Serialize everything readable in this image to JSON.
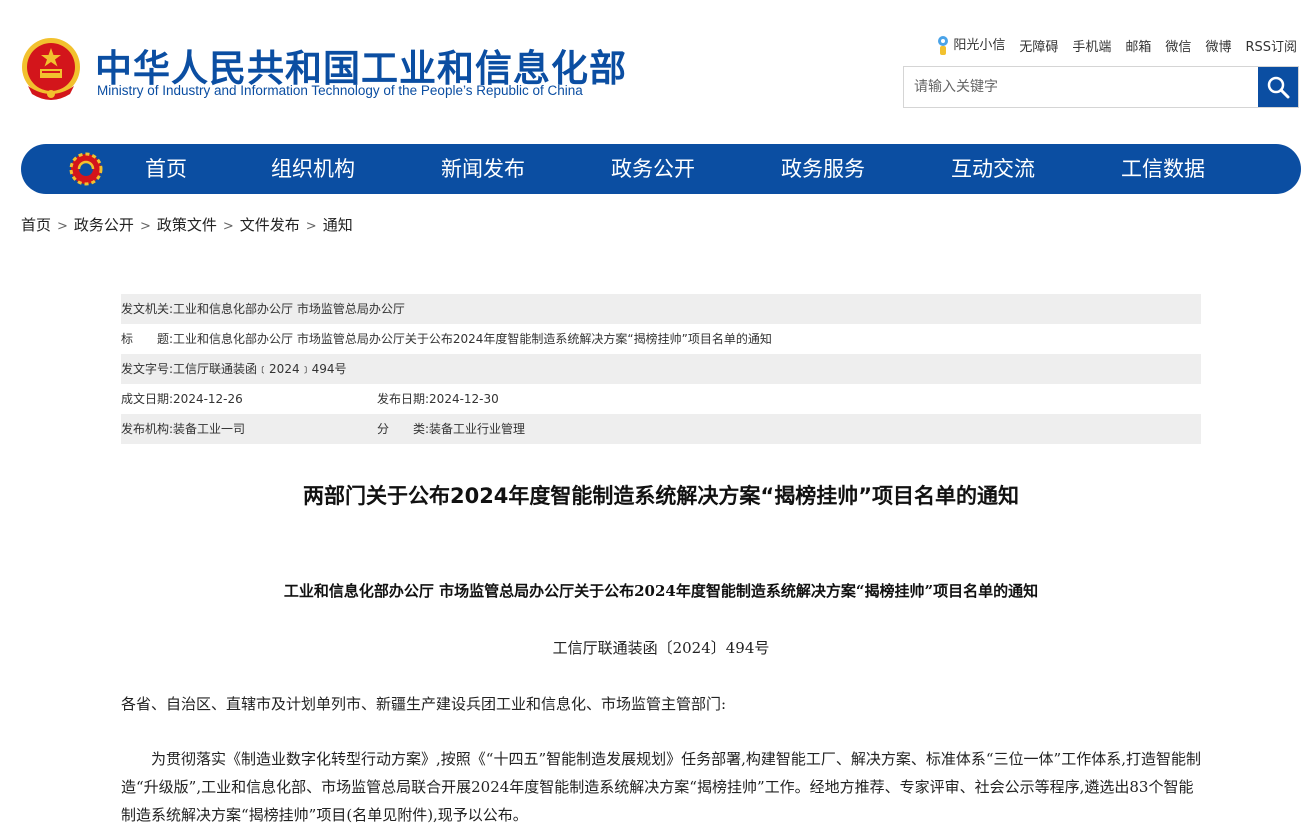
{
  "header": {
    "org_name_cn": "中华人民共和国工业和信息化部",
    "org_name_en": "Ministry of Industry and Information Technology of the People’s Republic of China",
    "emblem_icon": "national-emblem-icon",
    "top_links": [
      "阳光小信",
      "无障碍",
      "手机端",
      "邮箱",
      "微信",
      "微博",
      "RSS订阅"
    ],
    "search_placeholder": "请输入关键字"
  },
  "nav": {
    "items": [
      "首页",
      "组织机构",
      "新闻发布",
      "政务公开",
      "政务服务",
      "互动交流",
      "工信数据"
    ]
  },
  "breadcrumb": {
    "items": [
      "首页",
      "政务公开",
      "政策文件",
      "文件发布",
      "通知"
    ],
    "separator": ">"
  },
  "meta": {
    "issuer_label": "发文机关:",
    "issuer": "工业和信息化部办公厅 市场监管总局办公厅",
    "title_label": "标　　题:",
    "title": "工业和信息化部办公厅 市场监管总局办公厅关于公布2024年度智能制造系统解决方案“揭榜挂帅”项目名单的通知",
    "docno_label": "发文字号:",
    "docno": "工信厅联通装函﹝2024﹞494号",
    "created_label": "成文日期:",
    "created": "2024-12-26",
    "published_label": "发布日期:",
    "published": "2024-12-30",
    "agency_label": "发布机构:",
    "agency": "装备工业一司",
    "category_label": "分　　类:",
    "category": "装备工业行业管理"
  },
  "article": {
    "title": "两部门关于公布2024年度智能制造系统解决方案“揭榜挂帅”项目名单的通知",
    "subtitle": "工业和信息化部办公厅  市场监管总局办公厅关于公布2024年度智能制造系统解决方案“揭榜挂帅”项目名单的通知",
    "docno": "工信厅联通装函〔2024〕494号",
    "salutation": "各省、自治区、直辖市及计划单列市、新疆生产建设兵团工业和信息化、市场监管主管部门:",
    "paragraph1": "为贯彻落实《制造业数字化转型行动方案》,按照《“十四五”智能制造发展规划》任务部署,构建智能工厂、解决方案、标准体系“三位一体”工作体系,打造智能制造“升级版”,工业和信息化部、市场监管总局联合开展2024年度智能制造系统解决方案“揭榜挂帅”工作。经地方推荐、专家评审、社会公示等程序,遴选出83个智能制造系统解决方案“揭榜挂帅”项目(名单见附件),现予以公布。"
  },
  "colors": {
    "brand_blue": "#0b4ea2",
    "meta_row_bg": "#eeeeee",
    "emblem_red": "#d3151b",
    "emblem_gold": "#f2c12e"
  }
}
